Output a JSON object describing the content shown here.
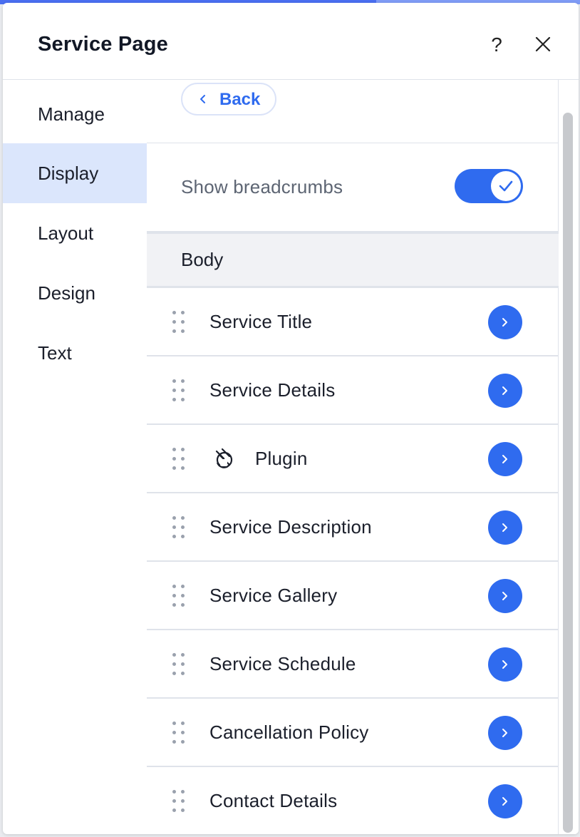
{
  "panel": {
    "title": "Service Page",
    "help_icon": "?",
    "close_icon": "close-icon"
  },
  "sidebar": {
    "items": [
      {
        "label": "Manage",
        "active": false
      },
      {
        "label": "Display",
        "active": true
      },
      {
        "label": "Layout",
        "active": false
      },
      {
        "label": "Design",
        "active": false
      },
      {
        "label": "Text",
        "active": false
      }
    ]
  },
  "content": {
    "back_label": "Back",
    "breadcrumbs": {
      "label": "Show breadcrumbs",
      "enabled": true
    },
    "section_title": "Body",
    "rows": [
      {
        "label": "Service Title"
      },
      {
        "label": "Service Details"
      },
      {
        "label": "Plugin",
        "icon": "plugin-icon"
      },
      {
        "label": "Service Description"
      },
      {
        "label": "Service Gallery"
      },
      {
        "label": "Service Schedule"
      },
      {
        "label": "Cancellation Policy"
      },
      {
        "label": "Contact Details"
      }
    ]
  },
  "colors": {
    "accent": "#2f6bef",
    "active_nav_bg": "#dbe6fc",
    "divider": "#dfe3ea"
  }
}
